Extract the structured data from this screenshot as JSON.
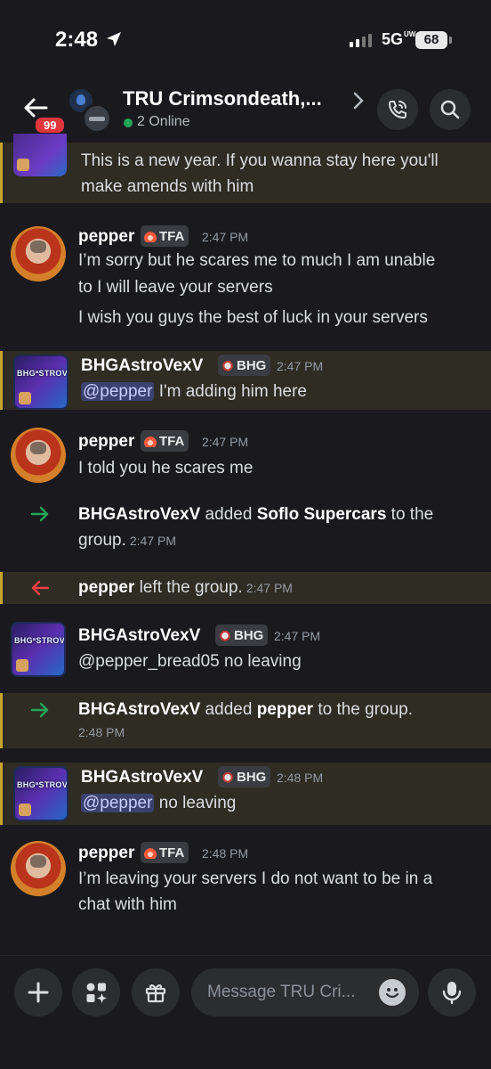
{
  "status": {
    "time": "2:48",
    "network": "5G",
    "network_sup": "UW",
    "battery": "68"
  },
  "header": {
    "badge": "99",
    "title": "TRU Crimsondeath,...",
    "online": "2 Online"
  },
  "messages": [
    {
      "kind": "cont",
      "lines": [
        "This is a new year. If you wanna stay here you'll",
        "make amends with him"
      ]
    },
    {
      "kind": "msg",
      "user": "pepper",
      "tag": "TFA",
      "time": "2:47 PM",
      "lines": [
        "I’m sorry but he scares me to much I am unable",
        "to I will leave your servers",
        "I wish you guys the best of luck in your servers"
      ]
    },
    {
      "kind": "msg",
      "user": "BHGAstroVexV",
      "tag": "BHG",
      "time": "2:47 PM",
      "mention": "@pepper",
      "after": " I'm adding him here"
    },
    {
      "kind": "msg",
      "user": "pepper",
      "tag": "TFA",
      "time": "2:47 PM",
      "lines": [
        "I told you he scares me"
      ]
    },
    {
      "kind": "sys",
      "actor": "BHGAstroVexV",
      "verb": " added ",
      "target": "Soflo Supercars",
      "rest1": " to the",
      "rest2": "group.",
      "time": "2:47 PM"
    },
    {
      "kind": "sys",
      "actor": "pepper",
      "verb": " left the group.",
      "time": "2:47 PM"
    },
    {
      "kind": "msg",
      "user": "BHGAstroVexV",
      "tag": "BHG",
      "time": "2:47 PM",
      "lines": [
        "@pepper_bread05 no leaving"
      ]
    },
    {
      "kind": "sys",
      "actor": "BHGAstroVexV",
      "verb": " added ",
      "target": "pepper",
      "rest1": " to the group.",
      "time": "2:48 PM"
    },
    {
      "kind": "msg",
      "user": "BHGAstroVexV",
      "tag": "BHG",
      "time": "2:48 PM",
      "mention": "@pepper",
      "after": " no leaving"
    },
    {
      "kind": "msg",
      "user": "pepper",
      "tag": "TFA",
      "time": "2:48 PM",
      "lines": [
        "I’m leaving your servers I do not want to be in a",
        "chat with him"
      ]
    }
  ],
  "composer": {
    "placeholder": "Message TRU Cri..."
  },
  "colors": {
    "join_arrow": "#23a55a",
    "leave_arrow": "#f23f43",
    "highlight_bar": "#c9a431",
    "mention_bg": "#3c4270"
  },
  "icons": [
    "back-arrow-icon",
    "chevron-right-icon",
    "phone-call-icon",
    "search-icon",
    "plus-icon",
    "apps-icon",
    "gift-icon",
    "emoji-icon",
    "microphone-icon",
    "location-arrow-icon"
  ]
}
